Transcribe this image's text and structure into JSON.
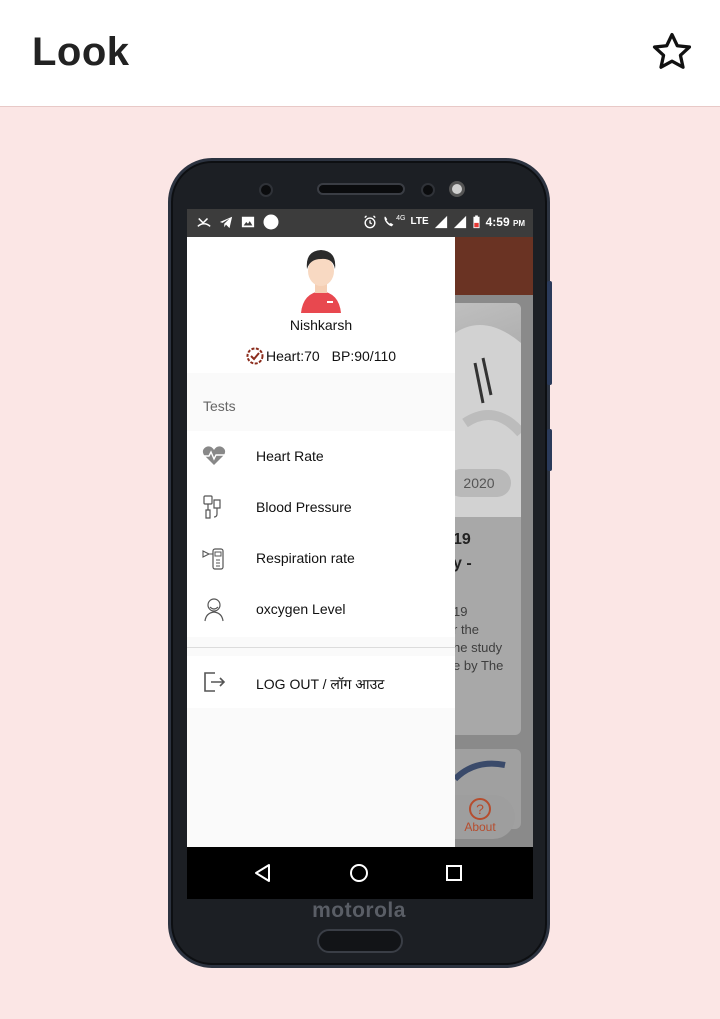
{
  "app_bar": {
    "title": "Look",
    "favorite_icon": "star-outline-icon"
  },
  "device": {
    "brand": "motorola"
  },
  "status_bar": {
    "time": "4:59",
    "ampm": "PM",
    "network_label": "4G",
    "lte_label": "LTE"
  },
  "drawer": {
    "profile": {
      "name": "Nishkarsh",
      "heart_label": "Heart:70",
      "bp_label": "BP:90/110"
    },
    "section_label": "Tests",
    "items": [
      {
        "label": "Heart Rate",
        "icon": "heart-pulse-icon"
      },
      {
        "label": "Blood Pressure",
        "icon": "blood-pressure-icon"
      },
      {
        "label": "Respiration rate",
        "icon": "respiration-device-icon"
      },
      {
        "label": "oxcygen Level",
        "icon": "oxygen-mask-icon"
      }
    ],
    "logout_label": "LOG OUT / लॉग आउट"
  },
  "background_app": {
    "date_pill": "2020",
    "title_fragment_1": "19",
    "title_fragment_2": "y -",
    "text_fragment_1": "19",
    "text_fragment_2": "r the",
    "text_fragment_3": "he study",
    "text_fragment_4": "e by The",
    "about_label": "About"
  },
  "colors": {
    "page_background": "#fbe6e5",
    "app_bar_accent": "#6a3323",
    "about_accent": "#b64d2e"
  }
}
